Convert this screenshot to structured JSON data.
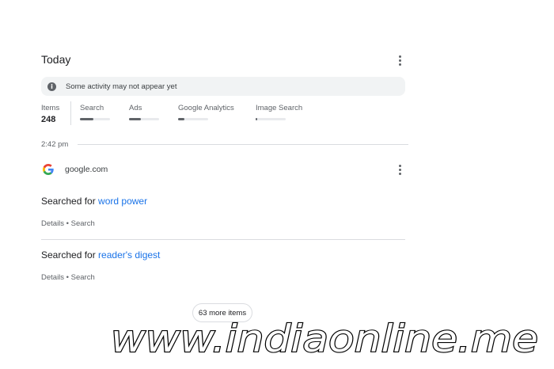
{
  "header": {
    "title": "Today"
  },
  "banner": {
    "text": "Some activity may not appear yet",
    "icon": "info-icon"
  },
  "stats": {
    "items_label": "Items",
    "items_count": "248",
    "sources": [
      {
        "label": "Search",
        "fraction": 0.45
      },
      {
        "label": "Ads",
        "fraction": 0.4
      },
      {
        "label": "Google Analytics",
        "fraction": 0.2
      },
      {
        "label": "Image Search",
        "fraction": 0.05
      }
    ]
  },
  "timeline": {
    "time": "2:42 pm"
  },
  "group": {
    "domain": "google.com"
  },
  "entries": [
    {
      "prefix": "Searched for ",
      "query": "word power",
      "meta": "Details • Search"
    },
    {
      "prefix": "Searched for ",
      "query": "reader's digest",
      "meta": "Details • Search"
    }
  ],
  "more_button": {
    "label": "63 more items"
  },
  "watermark": {
    "text": "www.indiaonline.me"
  },
  "colors": {
    "link": "#1a73e8",
    "text": "#202124",
    "secondary": "#5f6368",
    "banner_bg": "#f1f3f4"
  }
}
